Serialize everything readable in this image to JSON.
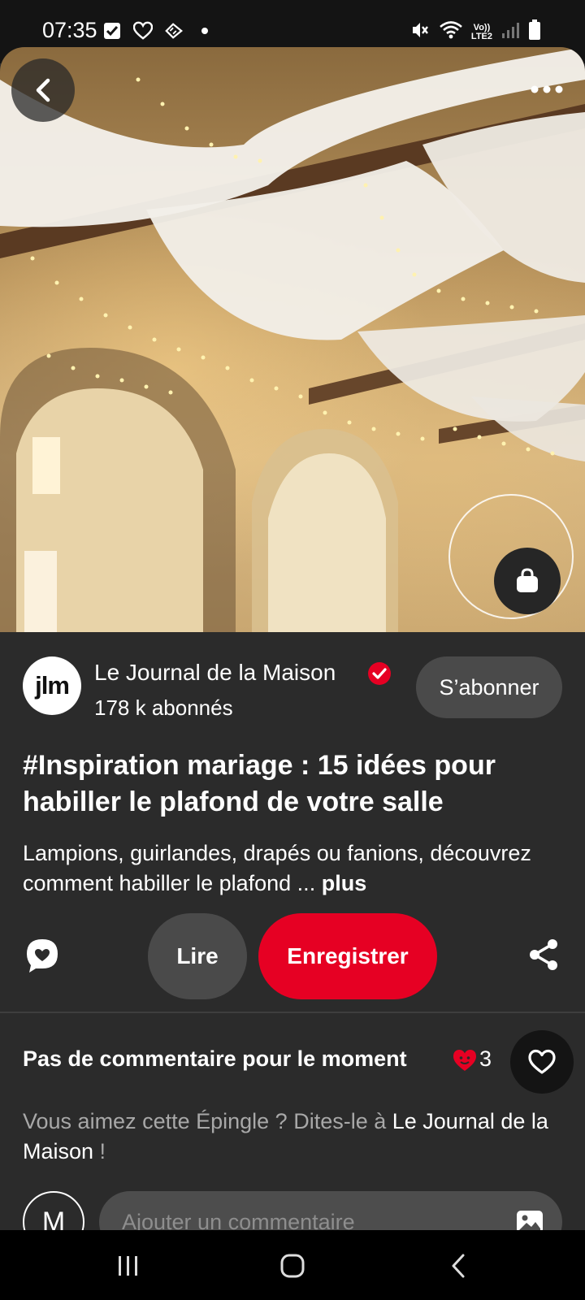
{
  "status_bar": {
    "time": "07:35",
    "left_icons": [
      "checkbox-icon",
      "heart-outline-icon",
      "tag-icon",
      "dot-icon"
    ],
    "network_label_top": "Vo))",
    "network_label_bottom": "LTE2",
    "right_icons": [
      "mute-icon",
      "wifi-icon",
      "signal-icon",
      "battery-icon"
    ]
  },
  "hero": {
    "overlay_buttons": [
      "back-icon",
      "more-icon",
      "shopping-bag-icon"
    ]
  },
  "author": {
    "avatar_text": "jlm",
    "name": "Le Journal de la Maison",
    "followers": "178 k abonnés",
    "follow_label": "S’abonner",
    "verified_color": "#e60023"
  },
  "pin": {
    "title": "#Inspiration mariage : 15 idées pour habiller le plafond de votre salle",
    "description": "Lampions, guirlandes, drapés ou fanions, découvrez comment habiller le plafond ...",
    "more_label": "plus"
  },
  "actions": {
    "read_label": "Lire",
    "save_label": "Enregistrer",
    "save_color": "#e60023"
  },
  "comments": {
    "heading": "Pas de commentaire pour le moment",
    "reaction_count": "3",
    "invite_prefix": "Vous aimez cette Épingle ? Dites-le à ",
    "invite_name": "Le Journal de la Maison",
    "invite_suffix": " !",
    "user_initial": "M",
    "input_placeholder": "Ajouter un commentaire"
  },
  "nav_bar": {
    "buttons": [
      "recent-apps-icon",
      "home-icon",
      "back-nav-icon"
    ]
  }
}
